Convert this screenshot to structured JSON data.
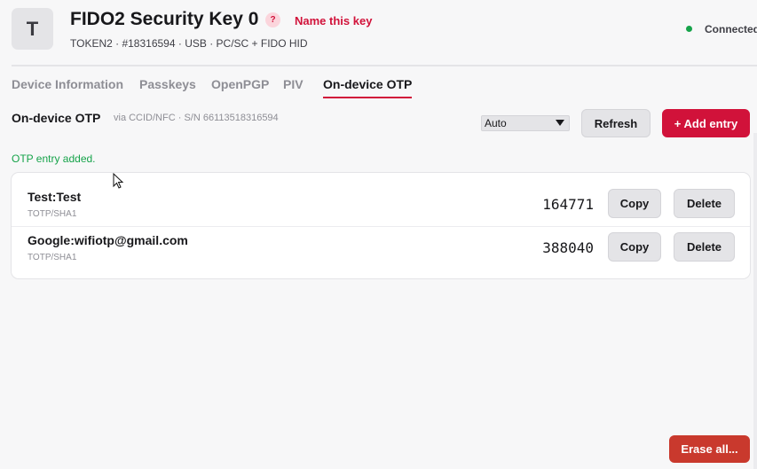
{
  "header": {
    "avatar_letter": "T",
    "title": "FIDO2 Security Key 0",
    "help_badge": "?",
    "name_link": "Name this key",
    "subtitle": "TOKEN2 · #18316594 · USB · PC/SC + FIDO HID",
    "status": "Connected",
    "status_color": "#16a34a"
  },
  "tabs": [
    {
      "label": "Device Information",
      "active": false
    },
    {
      "label": "Passkeys",
      "active": false
    },
    {
      "label": "OpenPGP",
      "active": false
    },
    {
      "label": "PIV",
      "active": false
    },
    {
      "label": "On-device OTP",
      "active": true
    }
  ],
  "section": {
    "title": "On-device OTP",
    "meta": "via CCID/NFC · S/N 66113518316594",
    "mode_select": "Auto",
    "refresh_label": "Refresh",
    "add_label": "+ Add entry"
  },
  "flash_message": "OTP entry added.",
  "entries": [
    {
      "name": "Test:Test",
      "type": "TOTP/SHA1",
      "code": "164771",
      "copy": "Copy",
      "delete": "Delete"
    },
    {
      "name": "Google:wifiotp@gmail.com",
      "type": "TOTP/SHA1",
      "code": "388040",
      "copy": "Copy",
      "delete": "Delete"
    }
  ],
  "footer": {
    "erase_label": "Erase all..."
  },
  "colors": {
    "accent": "#d1123a",
    "success": "#16a34a",
    "background": "#f7f7f8"
  }
}
